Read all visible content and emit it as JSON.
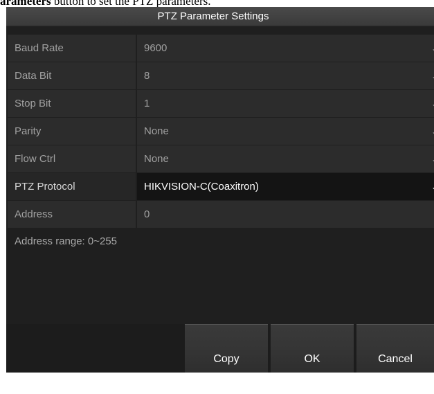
{
  "caption": {
    "bold": "arameters",
    "rest": " button to set the PTZ parameters."
  },
  "dialog": {
    "title": "PTZ Parameter Settings",
    "fields": [
      {
        "label": "Baud Rate",
        "value": "9600"
      },
      {
        "label": "Data Bit",
        "value": "8"
      },
      {
        "label": "Stop Bit",
        "value": "1"
      },
      {
        "label": "Parity",
        "value": "None"
      },
      {
        "label": "Flow Ctrl",
        "value": "None"
      },
      {
        "label": "PTZ Protocol",
        "value": "HIKVISION-C(Coaxitron)"
      },
      {
        "label": "Address",
        "value": "0"
      }
    ],
    "hint": "Address range: 0~255",
    "buttons": {
      "copy": "Copy",
      "ok": "OK",
      "cancel": "Cancel"
    }
  },
  "colors": {
    "dialog_bg": "#1f1f1f",
    "field_bg": "#2c2c2c",
    "active_field_bg": "#141414",
    "text": "#a0a0a0",
    "active_text": "#ffffff"
  },
  "icons": {
    "dropdown": "chevron-down-icon"
  }
}
